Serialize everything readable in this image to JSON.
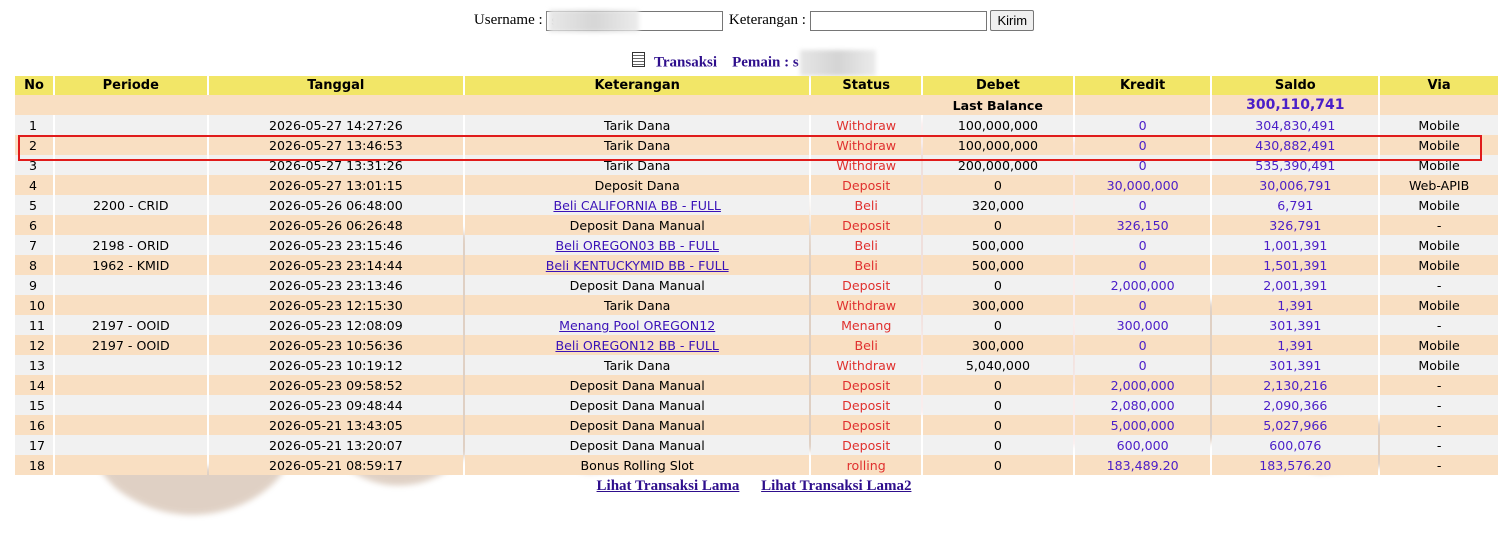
{
  "search": {
    "username_label": "Username :",
    "username_value": "s",
    "keterangan_label": "Keterangan :",
    "keterangan_value": "",
    "submit_label": "Kirim"
  },
  "heading": {
    "transaksi_label": "Transaksi",
    "pemain_label": "Pemain : s"
  },
  "table": {
    "columns": [
      "No",
      "Periode",
      "Tanggal",
      "Keterangan",
      "Status",
      "Debet",
      "Kredit",
      "Saldo",
      "Via"
    ],
    "last_balance_label": "Last Balance",
    "last_balance_value": "300,110,741",
    "rows": [
      {
        "no": "1",
        "periode": "",
        "tanggal": "2026-05-27 14:27:26",
        "keterangan": "Tarik Dana",
        "status": "Withdraw",
        "debet": "100,000,000",
        "kredit": "0",
        "saldo": "304,830,491",
        "via": "Mobile"
      },
      {
        "no": "2",
        "periode": "",
        "tanggal": "2026-05-27 13:46:53",
        "keterangan": "Tarik Dana",
        "status": "Withdraw",
        "debet": "100,000,000",
        "kredit": "0",
        "saldo": "430,882,491",
        "via": "Mobile"
      },
      {
        "no": "3",
        "periode": "",
        "tanggal": "2026-05-27 13:31:26",
        "keterangan": "Tarik Dana",
        "status": "Withdraw",
        "debet": "200,000,000",
        "kredit": "0",
        "saldo": "535,390,491",
        "via": "Mobile"
      },
      {
        "no": "4",
        "periode": "",
        "tanggal": "2026-05-27 13:01:15",
        "keterangan": "Deposit Dana",
        "status": "Deposit",
        "debet": "0",
        "kredit": "30,000,000",
        "saldo": "30,006,791",
        "via": "Web-APIB"
      },
      {
        "no": "5",
        "periode": "2200 - CRID",
        "tanggal": "2026-05-26 06:48:00",
        "keterangan": "Beli CALIFORNIA BB - FULL",
        "keterangan_link": true,
        "status": "Beli",
        "debet": "320,000",
        "kredit": "0",
        "saldo": "6,791",
        "via": "Mobile"
      },
      {
        "no": "6",
        "periode": "",
        "tanggal": "2026-05-26 06:26:48",
        "keterangan": "Deposit Dana Manual",
        "status": "Deposit",
        "debet": "0",
        "kredit": "326,150",
        "saldo": "326,791",
        "via": "-"
      },
      {
        "no": "7",
        "periode": "2198 - ORID",
        "tanggal": "2026-05-23 23:15:46",
        "keterangan": "Beli OREGON03 BB - FULL",
        "keterangan_link": true,
        "status": "Beli",
        "debet": "500,000",
        "kredit": "0",
        "saldo": "1,001,391",
        "via": "Mobile"
      },
      {
        "no": "8",
        "periode": "1962 - KMID",
        "tanggal": "2026-05-23 23:14:44",
        "keterangan": "Beli KENTUCKYMID BB - FULL",
        "keterangan_link": true,
        "status": "Beli",
        "debet": "500,000",
        "kredit": "0",
        "saldo": "1,501,391",
        "via": "Mobile"
      },
      {
        "no": "9",
        "periode": "",
        "tanggal": "2026-05-23 23:13:46",
        "keterangan": "Deposit Dana Manual",
        "status": "Deposit",
        "debet": "0",
        "kredit": "2,000,000",
        "saldo": "2,001,391",
        "via": "-"
      },
      {
        "no": "10",
        "periode": "",
        "tanggal": "2026-05-23 12:15:30",
        "keterangan": "Tarik Dana",
        "status": "Withdraw",
        "debet": "300,000",
        "kredit": "0",
        "saldo": "1,391",
        "via": "Mobile"
      },
      {
        "no": "11",
        "periode": "2197 - OOID",
        "tanggal": "2026-05-23 12:08:09",
        "keterangan": "Menang Pool OREGON12",
        "keterangan_link": true,
        "status": "Menang",
        "debet": "0",
        "kredit": "300,000",
        "saldo": "301,391",
        "via": "-"
      },
      {
        "no": "12",
        "periode": "2197 - OOID",
        "tanggal": "2026-05-23 10:56:36",
        "keterangan": "Beli OREGON12 BB - FULL",
        "keterangan_link": true,
        "status": "Beli",
        "debet": "300,000",
        "kredit": "0",
        "saldo": "1,391",
        "via": "Mobile"
      },
      {
        "no": "13",
        "periode": "",
        "tanggal": "2026-05-23 10:19:12",
        "keterangan": "Tarik Dana",
        "status": "Withdraw",
        "debet": "5,040,000",
        "kredit": "0",
        "saldo": "301,391",
        "via": "Mobile"
      },
      {
        "no": "14",
        "periode": "",
        "tanggal": "2026-05-23 09:58:52",
        "keterangan": "Deposit Dana Manual",
        "status": "Deposit",
        "debet": "0",
        "kredit": "2,000,000",
        "saldo": "2,130,216",
        "via": "-"
      },
      {
        "no": "15",
        "periode": "",
        "tanggal": "2026-05-23 09:48:44",
        "keterangan": "Deposit Dana Manual",
        "status": "Deposit",
        "debet": "0",
        "kredit": "2,080,000",
        "saldo": "2,090,366",
        "via": "-"
      },
      {
        "no": "16",
        "periode": "",
        "tanggal": "2026-05-21 13:43:05",
        "keterangan": "Deposit Dana Manual",
        "status": "Deposit",
        "debet": "0",
        "kredit": "5,000,000",
        "saldo": "5,027,966",
        "via": "-"
      },
      {
        "no": "17",
        "periode": "",
        "tanggal": "2026-05-21 13:20:07",
        "keterangan": "Deposit Dana Manual",
        "status": "Deposit",
        "debet": "0",
        "kredit": "600,000",
        "saldo": "600,076",
        "via": "-"
      },
      {
        "no": "18",
        "periode": "",
        "tanggal": "2026-05-21 08:59:17",
        "keterangan": "Bonus Rolling Slot",
        "status": "rolling",
        "debet": "0",
        "kredit": "183,489.20",
        "saldo": "183,576.20",
        "via": "-"
      }
    ]
  },
  "footer": {
    "link1": "Lihat Transaksi Lama",
    "link2": "Lihat Transaksi Lama2"
  },
  "colors": {
    "header_bg": "#f2e667",
    "row_odd": "#f1f1f1",
    "row_even": "#f9dfc2",
    "status_red": "#e0302e",
    "value_purple": "#4a1ec8",
    "highlight_red": "#e01b1b"
  }
}
